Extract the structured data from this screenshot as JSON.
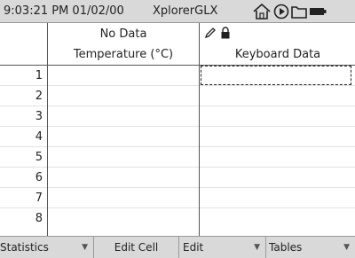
{
  "status_bar": {
    "time_date": "9:03:21 PM  01/02/00",
    "app_name": "XplorerGLX",
    "icons": [
      "home-icon",
      "play-icon",
      "folder-icon",
      "battery-icon"
    ]
  },
  "table": {
    "columns": [
      {
        "status": "No Data",
        "header": "Temperature  (°C)",
        "icons": []
      },
      {
        "status": "",
        "header": "Keyboard Data",
        "icons": [
          "pencil-icon",
          "lock-icon"
        ]
      }
    ],
    "row_numbers": [
      "1",
      "2",
      "3",
      "4",
      "5",
      "6",
      "7",
      "8"
    ],
    "selected_cell": {
      "row": 1,
      "column": 2
    }
  },
  "toolbar": {
    "buttons": [
      {
        "label": "Statistics",
        "has_dropdown": true
      },
      {
        "label": "Edit Cell",
        "has_dropdown": false
      },
      {
        "label": "Edit",
        "has_dropdown": true
      },
      {
        "label": "Tables",
        "has_dropdown": true
      }
    ]
  }
}
